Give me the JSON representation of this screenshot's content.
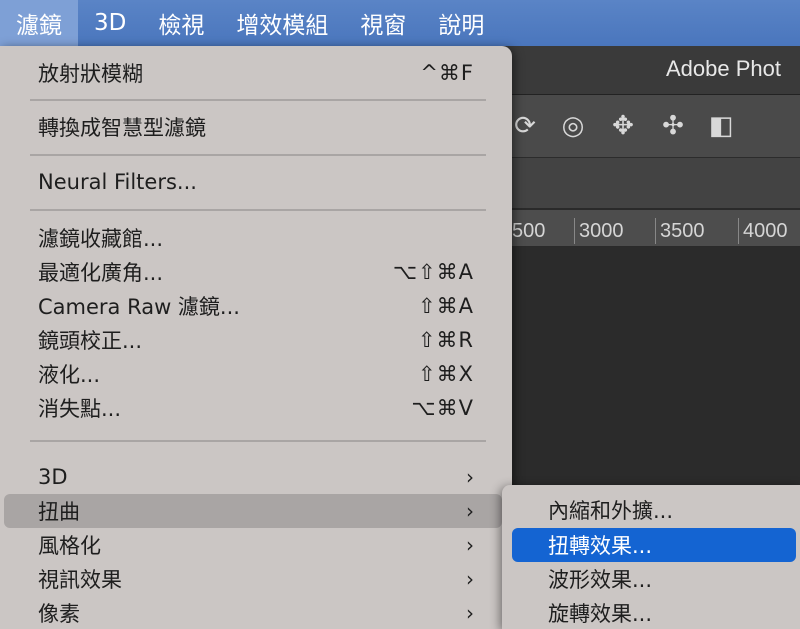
{
  "menubar": {
    "items": [
      "濾鏡",
      "3D",
      "檢視",
      "增效模組",
      "視窗",
      "說明"
    ]
  },
  "app": {
    "title": "Adobe Phot"
  },
  "ruler": {
    "ticks": [
      "500",
      "3000",
      "3500",
      "4000"
    ]
  },
  "menu": {
    "items": {
      "radial_blur": {
        "label": "放射狀模糊",
        "shortcut": "^⌘F"
      },
      "convert_smart": {
        "label": "轉換成智慧型濾鏡"
      },
      "neural": {
        "label": "Neural Filters..."
      },
      "gallery": {
        "label": "濾鏡收藏館..."
      },
      "adaptive_wide": {
        "label": "最適化廣角...",
        "shortcut": "⌥⇧⌘A"
      },
      "camera_raw": {
        "label": "Camera Raw 濾鏡...",
        "shortcut": "⇧⌘A"
      },
      "lens_correction": {
        "label": "鏡頭校正...",
        "shortcut": "⇧⌘R"
      },
      "liquify": {
        "label": "液化...",
        "shortcut": "⇧⌘X"
      },
      "vanishing_point": {
        "label": "消失點...",
        "shortcut": "⌥⌘V"
      },
      "three_d": {
        "label": "3D"
      },
      "distort": {
        "label": "扭曲"
      },
      "stylize": {
        "label": "風格化"
      },
      "video": {
        "label": "視訊效果"
      },
      "pixelate": {
        "label": "像素"
      }
    },
    "arrow": "›"
  },
  "submenu": {
    "items": [
      "內縮和外擴...",
      "扭轉效果...",
      "波形效果...",
      "旋轉效果..."
    ],
    "selected_color": "#1464d2"
  }
}
